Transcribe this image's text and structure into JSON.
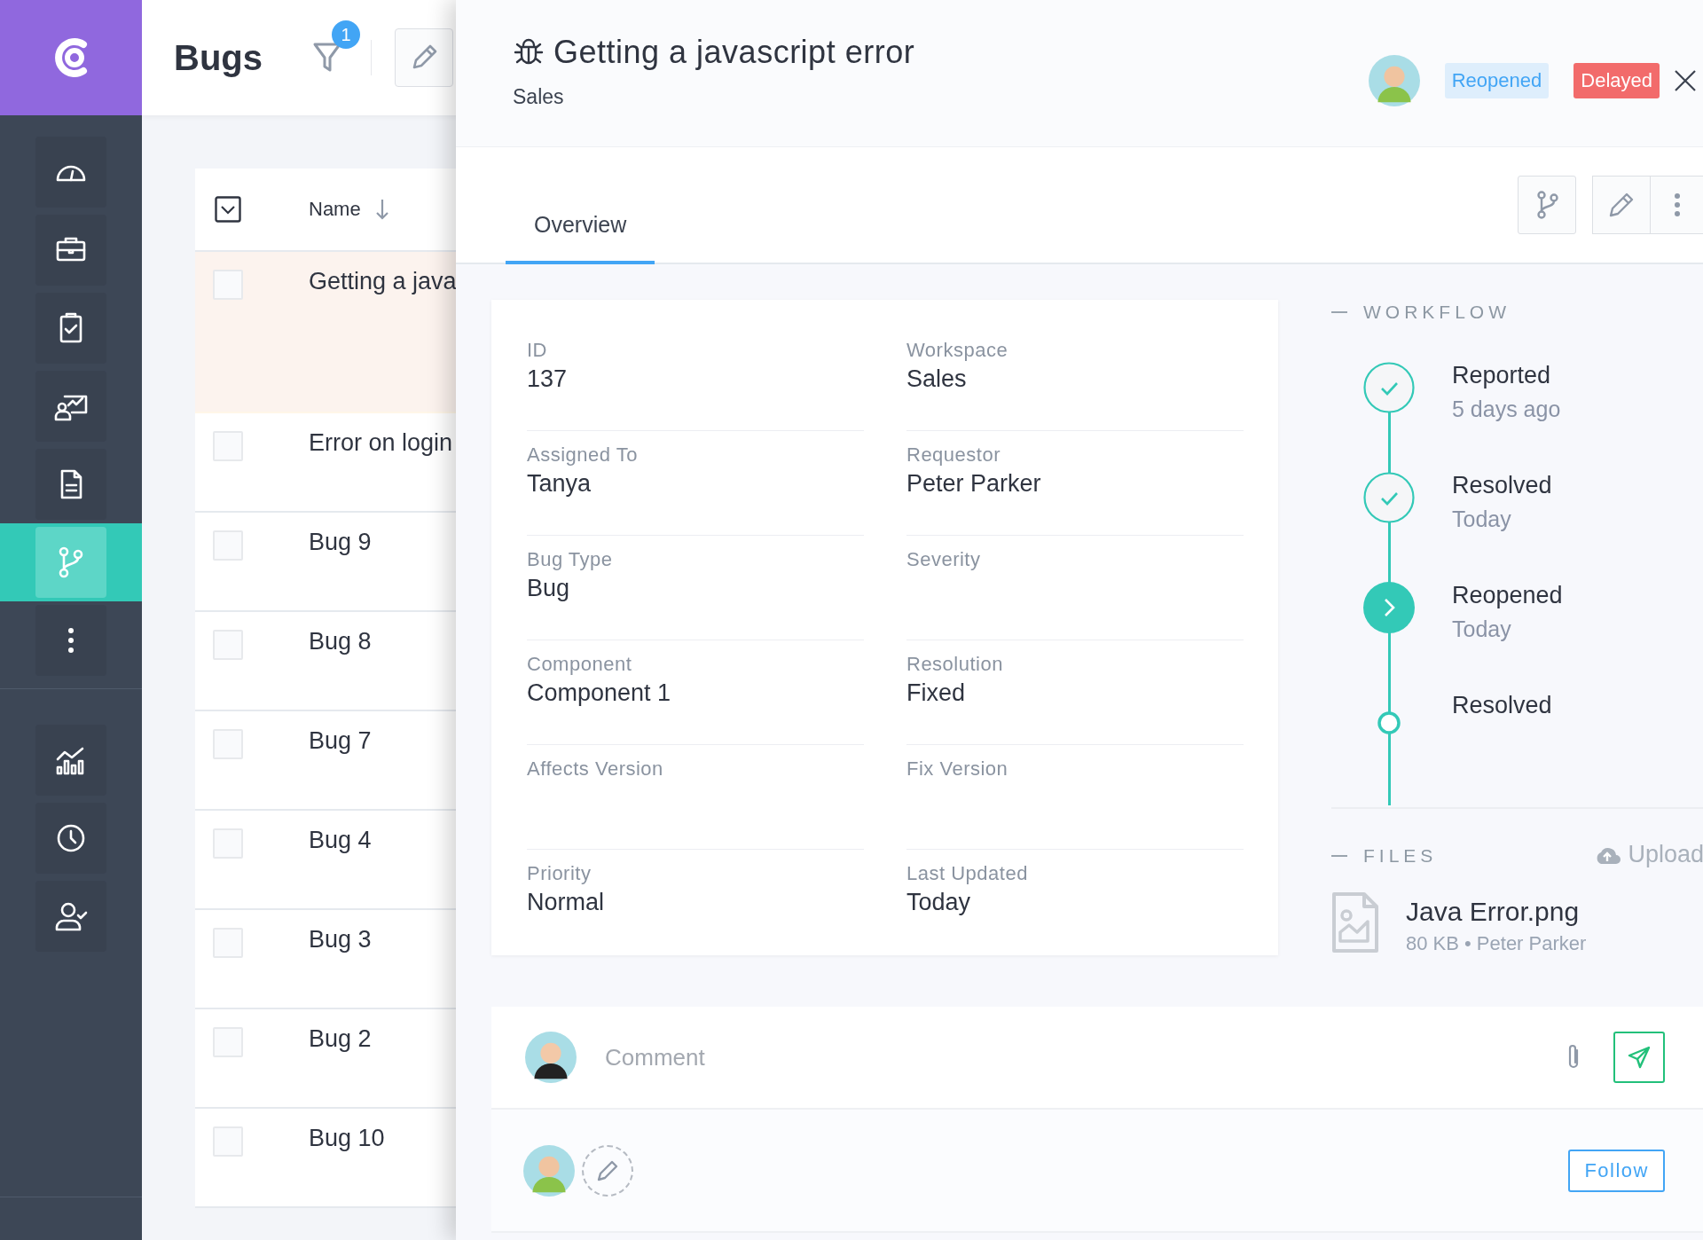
{
  "sidebar": {
    "items": [
      {
        "selected": false
      },
      {
        "selected": false
      },
      {
        "selected": false
      },
      {
        "selected": false
      },
      {
        "selected": false
      },
      {
        "selected": true
      },
      {
        "selected": false
      }
    ],
    "bottom_items": [
      {
        "selected": false
      },
      {
        "selected": false
      },
      {
        "selected": false
      }
    ]
  },
  "list": {
    "title": "Bugs",
    "filter_count": "1",
    "column": "Name",
    "select_all": {
      "checked": false
    },
    "rows": [
      {
        "name": "Getting a java",
        "selected": true,
        "checked": false
      },
      {
        "name": "Error on login",
        "selected": false,
        "checked": false
      },
      {
        "name": "Bug 9",
        "selected": false,
        "checked": false
      },
      {
        "name": "Bug 8",
        "selected": false,
        "checked": false
      },
      {
        "name": "Bug 7",
        "selected": false,
        "checked": false
      },
      {
        "name": "Bug 4",
        "selected": false,
        "checked": false
      },
      {
        "name": "Bug 3",
        "selected": false,
        "checked": false
      },
      {
        "name": "Bug 2",
        "selected": false,
        "checked": false
      },
      {
        "name": "Bug 10",
        "selected": false,
        "checked": false
      }
    ]
  },
  "panel": {
    "title": "Getting a javascript error",
    "subtitle": "Sales",
    "badges": [
      {
        "label": "Reopened",
        "kind": "light",
        "color": "#42a5f5"
      },
      {
        "label": "Delayed",
        "kind": "solid",
        "color": "#f26b6b"
      }
    ],
    "tabs": [
      {
        "label": "Overview",
        "selected": true
      }
    ],
    "fields": [
      {
        "label": "ID",
        "value": "137"
      },
      {
        "label": "Workspace",
        "value": "Sales"
      },
      {
        "label": "Assigned To",
        "value": "Tanya"
      },
      {
        "label": "Requestor",
        "value": "Peter Parker"
      },
      {
        "label": "Bug Type",
        "value": "Bug"
      },
      {
        "label": "Severity"
      },
      {
        "label": "Component",
        "value": "Component 1"
      },
      {
        "label": "Resolution",
        "value": "Fixed"
      },
      {
        "label": "Affects Version"
      },
      {
        "label": "Fix Version"
      },
      {
        "label": "Priority",
        "value": "Normal"
      },
      {
        "label": "Last Updated",
        "value": "Today"
      }
    ],
    "workflow": {
      "heading": "WORKFLOW",
      "steps": [
        {
          "name": "Reported",
          "time": "5 days ago",
          "kind": "done"
        },
        {
          "name": "Resolved",
          "time": "Today",
          "kind": "done"
        },
        {
          "name": "Reopened",
          "time": "Today",
          "kind": "current"
        },
        {
          "name": "Resolved",
          "kind": "pending"
        }
      ]
    },
    "files": {
      "heading": "FILES",
      "upload": "Upload",
      "items": [
        {
          "name": "Java Error.png",
          "meta": "80 KB • Peter Parker"
        }
      ]
    },
    "comment": {
      "placeholder": "Comment"
    },
    "follow": "Follow"
  }
}
